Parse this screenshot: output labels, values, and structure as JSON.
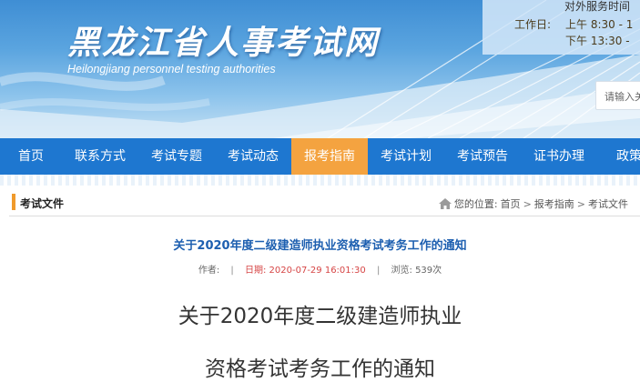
{
  "header": {
    "site_title": "黑龙江省人事考试网",
    "site_subtitle": "Heilongjiang personnel testing authorities",
    "service": {
      "title": "对外服务时间",
      "label": "工作日:",
      "am": "上午  8:30 - 1",
      "pm": "下午 13:30 -"
    },
    "search": {
      "placeholder": "请输入关"
    }
  },
  "nav": {
    "items": [
      {
        "label": "首页"
      },
      {
        "label": "联系方式"
      },
      {
        "label": "考试专题"
      },
      {
        "label": "考试动态"
      },
      {
        "label": "报考指南"
      },
      {
        "label": "考试计划"
      },
      {
        "label": "考试预告"
      },
      {
        "label": "证书办理"
      },
      {
        "label": "政策法"
      }
    ],
    "active_index": 4
  },
  "section": {
    "title": "考试文件",
    "breadcrumb": {
      "prefix": "您的位置:",
      "home": "首页",
      "guide": "报考指南",
      "current": "考试文件",
      "separator": ">"
    }
  },
  "article": {
    "title": "关于2020年度二级建造师执业资格考试考务工作的通知",
    "meta": {
      "author_label": "作者:",
      "author": "",
      "date_label": "日期:",
      "date": "2020-07-29 16:01:30",
      "views_label": "浏览:",
      "views": "539次"
    },
    "heading_lines": [
      "关于2020年度二级建造师执业",
      "资格考试考务工作的通知"
    ]
  },
  "colors": {
    "nav_bg": "#1e77d0",
    "nav_active": "#f4a340",
    "accent_bar": "#f09a2b",
    "title_blue": "#1d5fb0",
    "date_red": "#d64545"
  }
}
